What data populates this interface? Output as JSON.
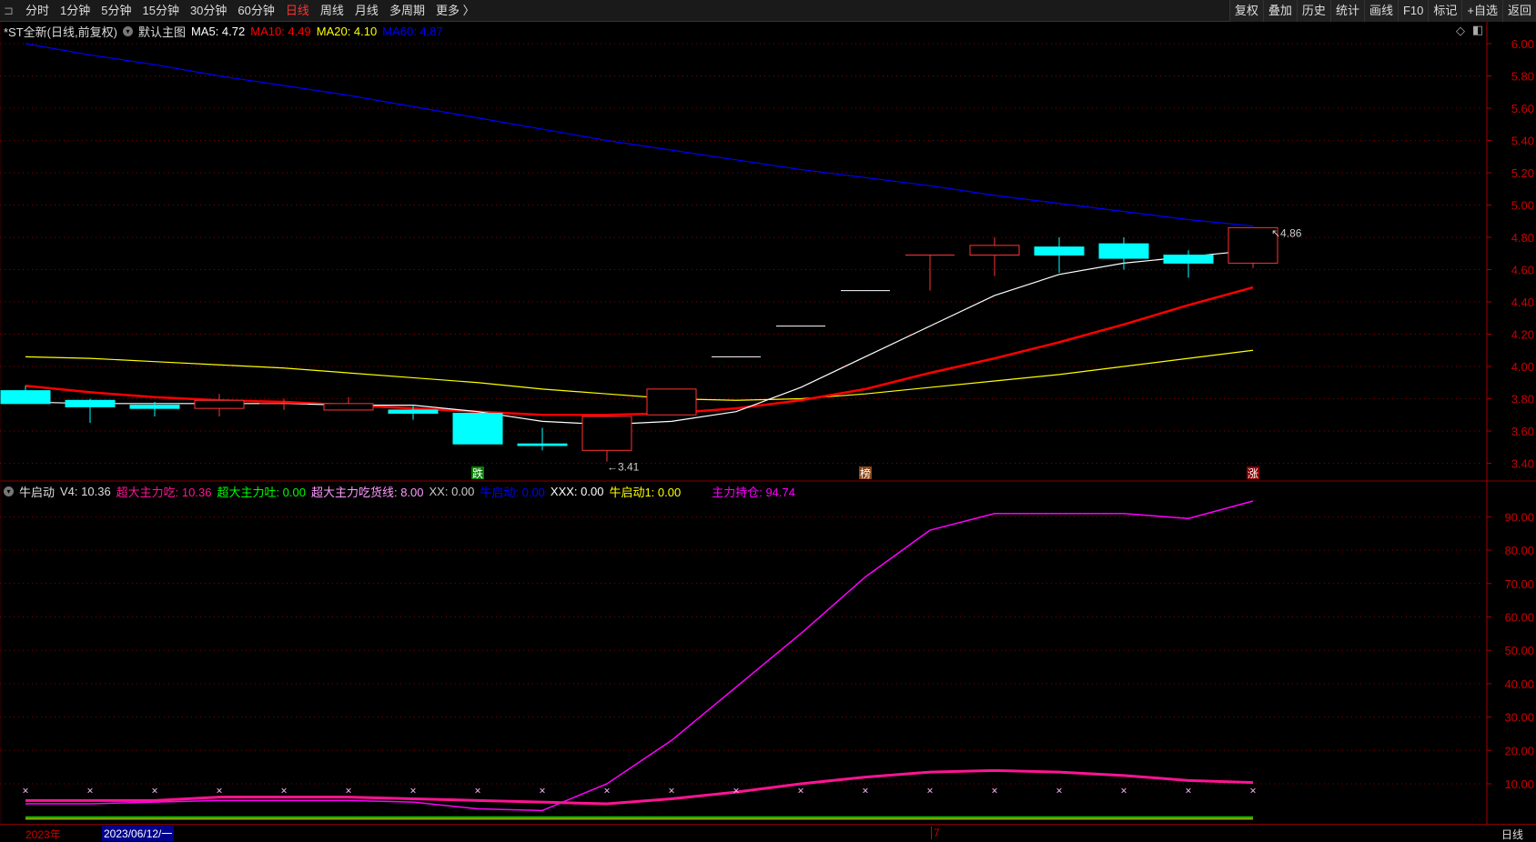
{
  "menu": {
    "items": [
      "分时",
      "1分钟",
      "5分钟",
      "15分钟",
      "30分钟",
      "60分钟",
      "日线",
      "周线",
      "月线",
      "多周期",
      "更多 〉"
    ],
    "active": "日线"
  },
  "tools": [
    "复权",
    "叠加",
    "历史",
    "统计",
    "画线",
    "F10",
    "标记",
    "+自选",
    "返回"
  ],
  "main_legend": {
    "title": "*ST全新(日线,前复权)",
    "template": "默认主图",
    "ma5": "MA5: 4.72",
    "ma10": "MA10: 4.49",
    "ma20": "MA20: 4.10",
    "ma60": "MA60: 4.87"
  },
  "ind_legend": {
    "name": "牛启动",
    "v4": "V4: 10.36",
    "a": "超大主力吃: 10.36",
    "b": "超大主力吐: 0.00",
    "c": "超大主力吃货线: 8.00",
    "d": "XX: 0.00",
    "e": "牛启动: 0.00",
    "f": "XXX: 0.00",
    "g": "牛启动1: 0.00",
    "h": "主力持仓: 94.74"
  },
  "colors": {
    "up": "#ff3232",
    "down": "#00ffff",
    "ma5": "#ffffff",
    "ma10": "#ff0000",
    "ma20": "#ffff00",
    "ma60": "#0000ff",
    "axis": "#c00000"
  },
  "chart_data": [
    {
      "type": "candlestick",
      "ylim": [
        3.3,
        6.05
      ],
      "yticks": [
        "6.00",
        "5.80",
        "5.60",
        "5.40",
        "5.20",
        "5.00",
        "4.80",
        "4.60",
        "4.40",
        "4.20",
        "4.00",
        "3.80",
        "3.60",
        "3.40"
      ],
      "ohlc": [
        [
          3.85,
          3.88,
          3.77,
          3.77
        ],
        [
          3.79,
          3.8,
          3.65,
          3.75
        ],
        [
          3.76,
          3.78,
          3.69,
          3.74
        ],
        [
          3.74,
          3.83,
          3.69,
          3.79
        ],
        [
          3.77,
          3.8,
          3.73,
          3.77
        ],
        [
          3.73,
          3.81,
          3.73,
          3.77
        ],
        [
          3.73,
          3.76,
          3.67,
          3.71
        ],
        [
          3.71,
          3.71,
          3.52,
          3.52
        ],
        [
          3.52,
          3.62,
          3.48,
          3.51
        ],
        [
          3.48,
          3.69,
          3.41,
          3.69
        ],
        [
          3.7,
          3.86,
          3.7,
          3.86
        ],
        [
          4.06,
          4.06,
          4.06,
          4.06
        ],
        [
          4.25,
          4.25,
          4.25,
          4.25
        ],
        [
          4.47,
          4.47,
          4.47,
          4.47
        ],
        [
          4.69,
          4.69,
          4.47,
          4.69
        ],
        [
          4.69,
          4.8,
          4.56,
          4.75
        ],
        [
          4.74,
          4.8,
          4.58,
          4.69
        ],
        [
          4.76,
          4.8,
          4.6,
          4.67
        ],
        [
          4.69,
          4.72,
          4.55,
          4.64
        ],
        [
          4.64,
          4.86,
          4.61,
          4.86
        ]
      ],
      "ma5": [
        3.78,
        3.77,
        3.77,
        3.77,
        3.77,
        3.76,
        3.76,
        3.72,
        3.66,
        3.64,
        3.66,
        3.72,
        3.87,
        4.06,
        4.25,
        4.44,
        4.57,
        4.64,
        4.68,
        4.72
      ],
      "ma10": [
        3.88,
        3.84,
        3.81,
        3.79,
        3.78,
        3.76,
        3.74,
        3.72,
        3.7,
        3.7,
        3.71,
        3.74,
        3.79,
        3.86,
        3.96,
        4.05,
        4.15,
        4.26,
        4.38,
        4.49
      ],
      "ma20": [
        4.06,
        4.05,
        4.03,
        4.01,
        3.99,
        3.96,
        3.93,
        3.9,
        3.86,
        3.83,
        3.8,
        3.79,
        3.8,
        3.83,
        3.87,
        3.91,
        3.95,
        4.0,
        4.05,
        4.1
      ],
      "ma60": [
        6.0,
        5.93,
        5.87,
        5.8,
        5.74,
        5.68,
        5.61,
        5.54,
        5.47,
        5.4,
        5.34,
        5.28,
        5.22,
        5.17,
        5.12,
        5.06,
        5.01,
        4.96,
        4.91,
        4.87
      ],
      "annotations": {
        "high": "4.86",
        "low": "3.41"
      },
      "markers": [
        {
          "index": 7,
          "text": "跌",
          "color": "#008000"
        },
        {
          "index": 13,
          "text": "榜",
          "color": "#8b4513"
        },
        {
          "index": 19,
          "text": "涨",
          "color": "#8b0000"
        }
      ]
    },
    {
      "type": "line",
      "ylim": [
        0,
        100
      ],
      "yticks": [
        "90.00",
        "80.00",
        "70.00",
        "60.00",
        "50.00",
        "40.00",
        "30.00",
        "20.00",
        "10.00"
      ],
      "series": [
        {
          "name": "主力持仓",
          "color": "#ff00ff",
          "values": [
            4,
            4,
            4.5,
            5,
            5,
            5,
            4.5,
            2.5,
            2,
            10,
            23,
            39,
            55,
            72,
            86,
            91,
            91,
            91,
            89.5,
            94.74
          ]
        },
        {
          "name": "超大主力吃",
          "color": "#ff1493",
          "values": [
            5,
            5,
            5,
            6,
            6,
            6,
            5.5,
            5,
            4.5,
            4,
            5.5,
            7.5,
            10,
            12,
            13.5,
            14,
            13.5,
            12.5,
            11,
            10.36
          ]
        },
        {
          "name": "超大主力吐",
          "color": "#00ff00",
          "values": [
            0,
            0,
            0,
            0,
            0,
            0,
            0,
            0,
            0,
            0,
            0,
            0,
            0,
            0,
            0,
            0,
            0,
            0,
            0,
            0
          ]
        },
        {
          "name": "超大主力吃货线",
          "color": "#ffb6ff",
          "marker": "x",
          "values": [
            8,
            8,
            8,
            8,
            8,
            8,
            8,
            8,
            8,
            8,
            8,
            8,
            8,
            8,
            8,
            8,
            8,
            8,
            8,
            8
          ]
        }
      ]
    }
  ],
  "time_axis": {
    "year": "2023年",
    "cursor": "2023/06/12/一",
    "month": "7",
    "period": "日线"
  }
}
